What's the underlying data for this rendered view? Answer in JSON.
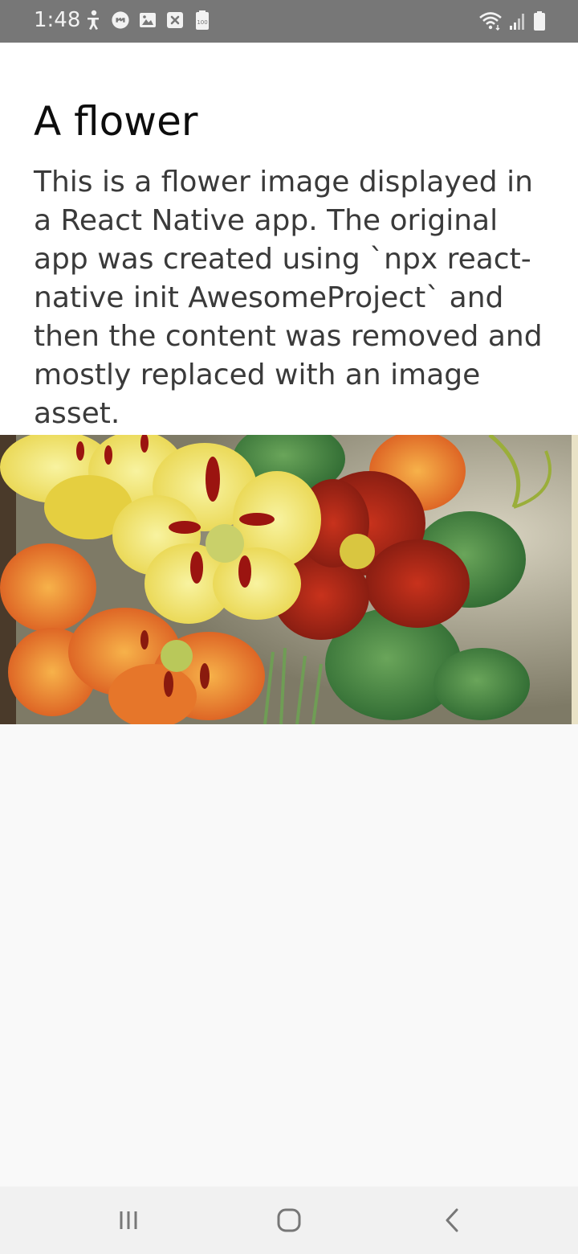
{
  "status_bar": {
    "time": "1:48",
    "left_icons": [
      "accessibility-icon",
      "messenger-icon",
      "gallery-icon",
      "close-box-icon",
      "battery-100-icon"
    ],
    "right_icons": [
      "wifi-icon",
      "signal-icon",
      "battery-icon"
    ],
    "battery_badge": "100"
  },
  "page": {
    "title": "A flower",
    "description": "This is a flower image displayed in a React Native app. The original app was created using `npx react-native init AwesomeProject` and then the content was removed and mostly replaced with an image asset."
  },
  "image": {
    "subject": "flower-image"
  },
  "nav_bar": {
    "buttons": [
      "recent-apps",
      "home",
      "back"
    ]
  },
  "colors": {
    "status_bar_bg": "#777777",
    "content_bg": "#ffffff",
    "page_bg": "#f9f9f9",
    "nav_bar_bg": "#f1f1f1"
  }
}
